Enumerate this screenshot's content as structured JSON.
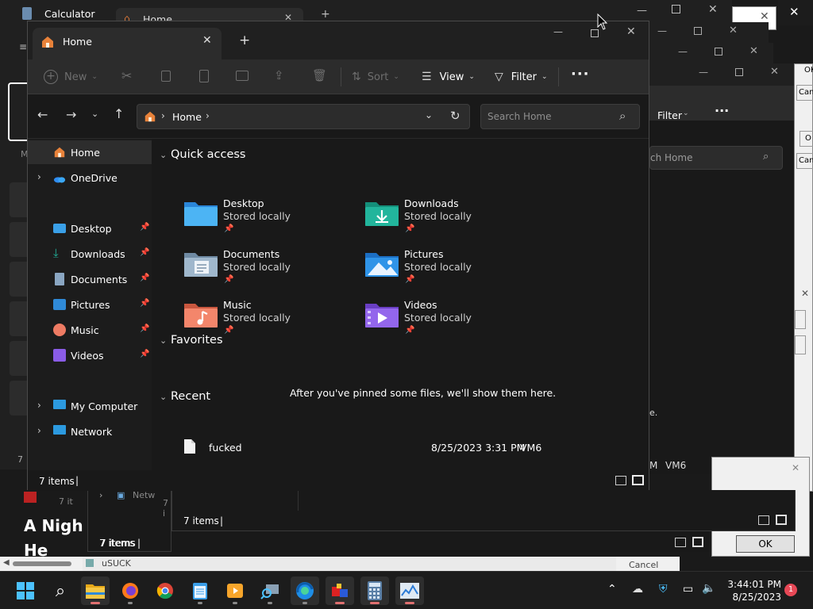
{
  "background": {
    "calculator_title": "Calculator",
    "bg_tab_label": "Home",
    "bg_filter_label": "Filter",
    "bg_search_placeholder": "ch Home",
    "bg_status1": "7 items",
    "bg_status2": "7 items",
    "bg_status3": "7 items",
    "bg_text_e": "e.",
    "bg_recent_time": "M",
    "bg_recent_loc": "VM6",
    "headline": "A Nigh... He Says...",
    "headline_line1": "A Nigh",
    "headline_line2": "He Says",
    "side_ok": "OK",
    "side_can": "Canc",
    "side_o": "O",
    "side_can2": "Can",
    "ok_button": "OK",
    "cancel_button": "Cancel",
    "usuck_label": "uSUCK",
    "net_label": "Netw",
    "item7_label": "7 it",
    "item7_label2": "7 i",
    "m_label": "M",
    "seven": "7"
  },
  "window": {
    "tab_label": "Home",
    "new_tab": "+",
    "toolbar": {
      "new_label": "New",
      "sort_label": "Sort",
      "view_label": "View",
      "filter_label": "Filter",
      "more_label": "..."
    },
    "address": {
      "crumbs": [
        "Home"
      ],
      "search_placeholder": "Search Home"
    },
    "nav": {
      "home": "Home",
      "onedrive": "OneDrive",
      "pinned": [
        {
          "label": "Desktop",
          "icon": "desktop-icon"
        },
        {
          "label": "Downloads",
          "icon": "downloads-icon"
        },
        {
          "label": "Documents",
          "icon": "documents-icon"
        },
        {
          "label": "Pictures",
          "icon": "pictures-icon"
        },
        {
          "label": "Music",
          "icon": "music-icon"
        },
        {
          "label": "Videos",
          "icon": "videos-icon"
        }
      ],
      "my_computer": "My Computer",
      "network": "Network"
    },
    "content": {
      "quick_access_title": "Quick access",
      "folders": [
        {
          "name": "Desktop",
          "sub": "Stored locally",
          "icon": "desktop-folder-icon"
        },
        {
          "name": "Downloads",
          "sub": "Stored locally",
          "icon": "downloads-folder-icon"
        },
        {
          "name": "Documents",
          "sub": "Stored locally",
          "icon": "documents-folder-icon"
        },
        {
          "name": "Pictures",
          "sub": "Stored locally",
          "icon": "pictures-folder-icon"
        },
        {
          "name": "Music",
          "sub": "Stored locally",
          "icon": "music-folder-icon"
        },
        {
          "name": "Videos",
          "sub": "Stored locally",
          "icon": "videos-folder-icon"
        }
      ],
      "favorites_title": "Favorites",
      "favorites_empty": "After you've pinned some files, we'll show them here.",
      "recent_title": "Recent",
      "recent_items": [
        {
          "name": "fucked",
          "date": "8/25/2023 3:31 PM",
          "location": "VM6"
        }
      ]
    },
    "status": {
      "items": "7 items"
    }
  },
  "taskbar": {
    "time": "3:44:01 PM",
    "date": "8/25/2023",
    "notification_count": "1"
  },
  "colors": {
    "accent": "#4cc2ff",
    "folder_blue": "#3aa0e8",
    "downloads_green": "#21b29a",
    "music_orange": "#f08a5d",
    "videos_purple": "#8a5ce6",
    "notification_red": "#e74856"
  }
}
